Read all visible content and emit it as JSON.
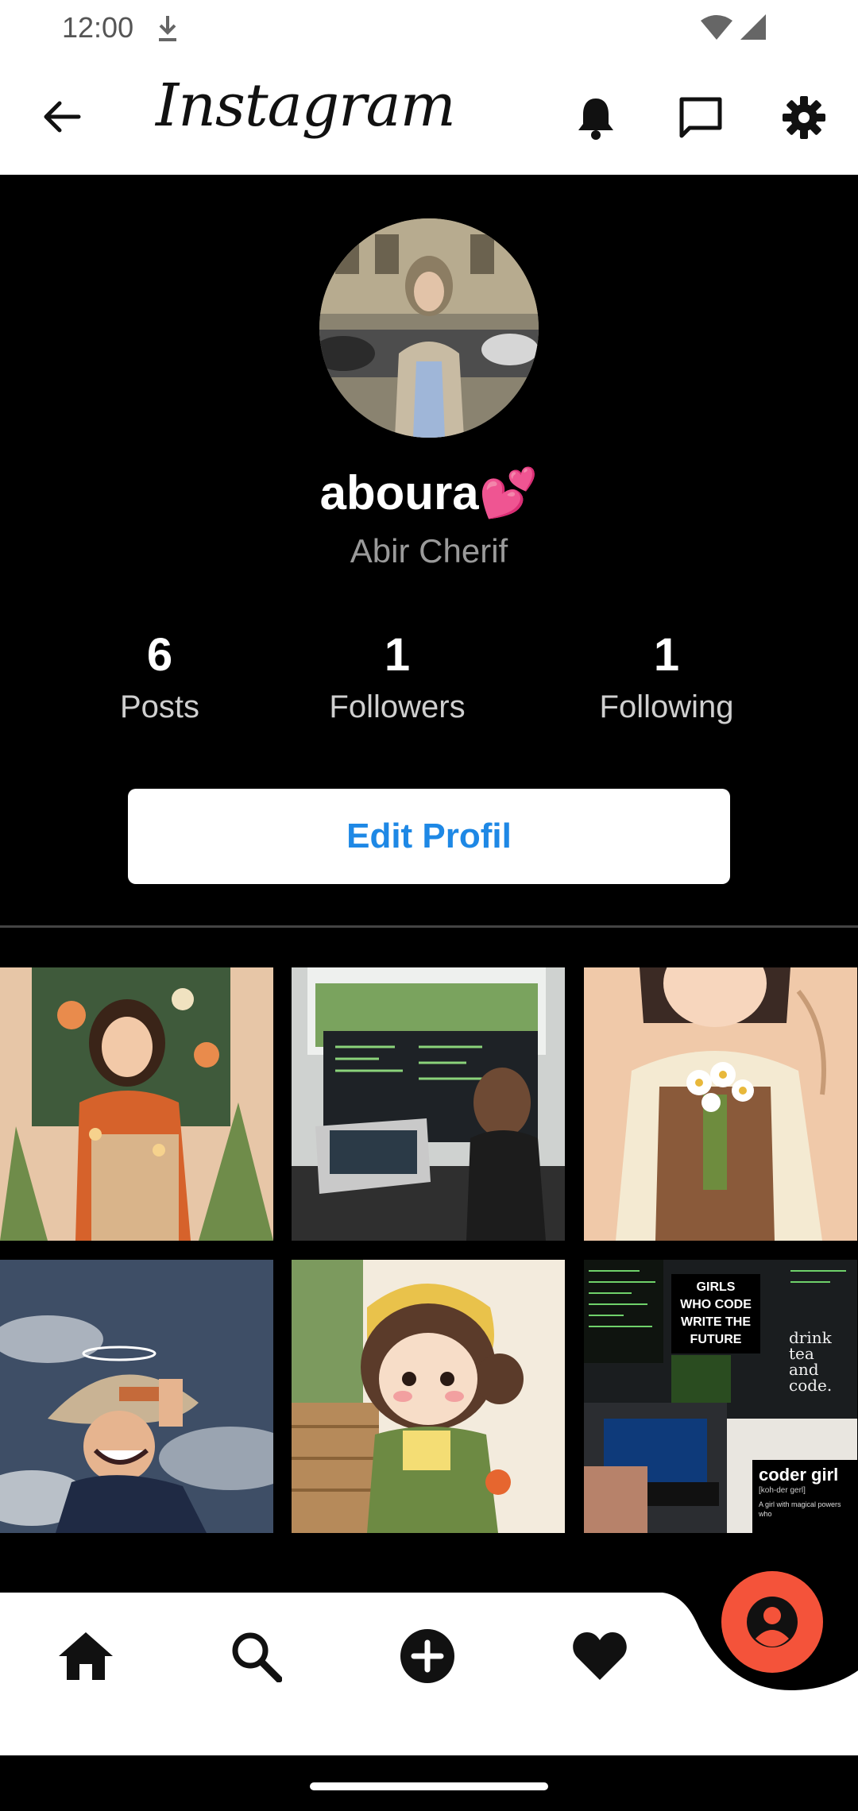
{
  "status_bar": {
    "time": "12:00"
  },
  "app_bar": {
    "brand": "Instagram"
  },
  "profile": {
    "username": "aboura💕",
    "full_name": "Abir Cherif",
    "stats": [
      {
        "value": "6",
        "label": "Posts"
      },
      {
        "value": "1",
        "label": "Followers"
      },
      {
        "value": "1",
        "label": "Following"
      }
    ],
    "edit_button": "Edit Profil"
  },
  "grid": {
    "tiles": [
      {
        "subject": "illustrated woman in orange sweater"
      },
      {
        "subject": "person coding at desk with laptop and monitor"
      },
      {
        "subject": "illustrated girl holding daisies"
      },
      {
        "subject": "anime character with straw hat at night"
      },
      {
        "subject": "chibi girl in green outfit"
      },
      {
        "subject": "coding collage",
        "caption_lines": [
          "GIRLS",
          "WHO CODE",
          "WRITE THE",
          "FUTURE"
        ],
        "tea_lines": [
          "drink tea",
          "and code."
        ],
        "coder_title": "coder girl",
        "coder_phonetic": "[koh-der gerl]",
        "coder_def": "A girl with magical powers who"
      }
    ]
  },
  "colors": {
    "accent": "#f4533a",
    "link_blue": "#1e88e5",
    "background": "#000000"
  },
  "icons": [
    "back-arrow-icon",
    "bell-icon",
    "chat-icon",
    "gear-icon",
    "home-icon",
    "search-icon",
    "add-circle-icon",
    "heart-icon",
    "profile-icon"
  ]
}
